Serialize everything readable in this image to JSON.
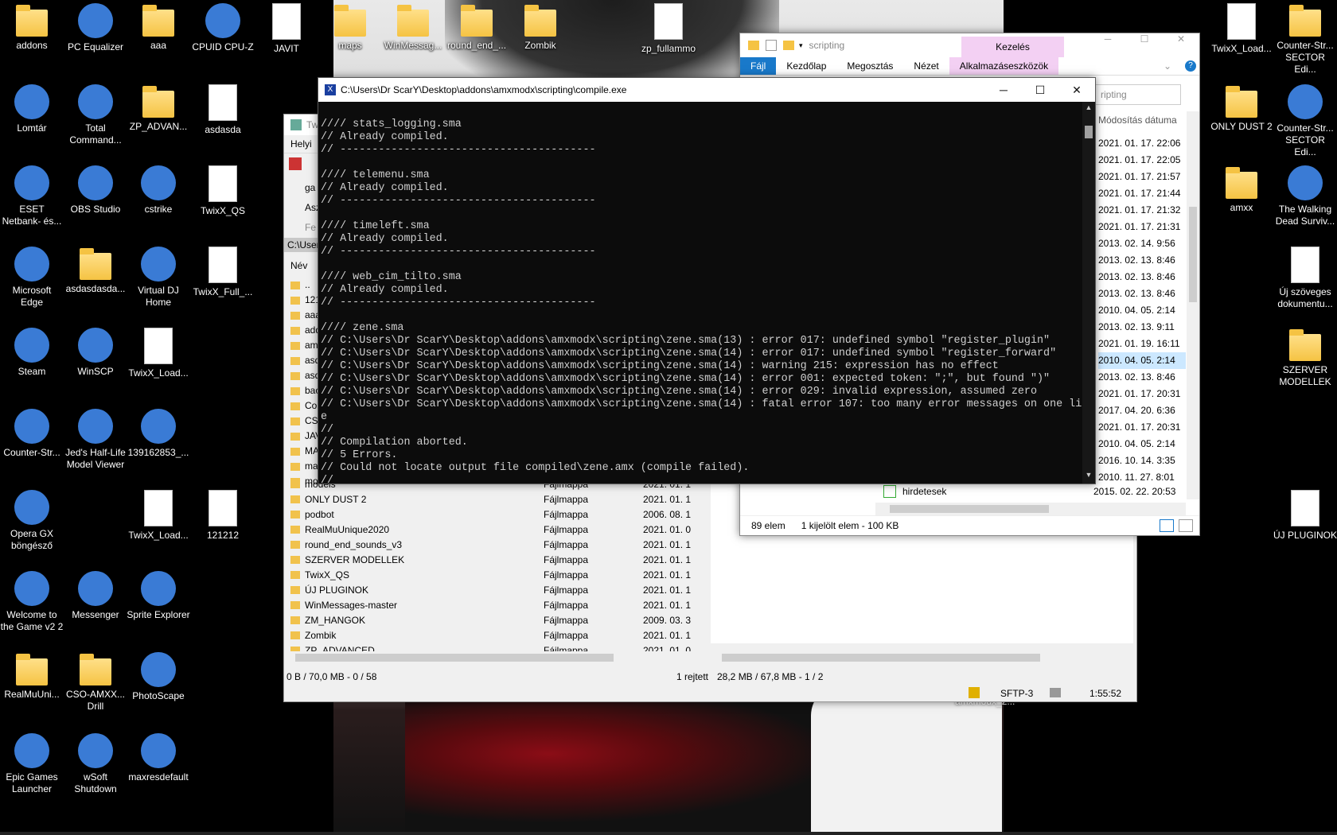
{
  "desktop": {
    "icons_left": [
      {
        "label": "addons",
        "icon": "folder-icon"
      },
      {
        "label": "PC Equalizer",
        "icon": "equalizer-icon"
      },
      {
        "label": "aaa",
        "icon": "folder-icon"
      },
      {
        "label": "CPUID CPU-Z",
        "icon": "cpu-icon"
      },
      {
        "label": "JAVIT",
        "icon": "text-file-icon"
      },
      {
        "label": "Lomtár",
        "icon": "recycle-bin-icon"
      },
      {
        "label": "Total Command...",
        "icon": "floppy-icon"
      },
      {
        "label": "ZP_ADVAN...",
        "icon": "folder-icon"
      },
      {
        "label": "asdasda",
        "icon": "text-file-icon"
      },
      {
        "label": "ESET Netbank- és...",
        "icon": "eset-icon"
      },
      {
        "label": "OBS Studio",
        "icon": "obs-icon"
      },
      {
        "label": "cstrike",
        "icon": "winrar-icon"
      },
      {
        "label": "TwixX_QS",
        "icon": "disc-file-icon"
      },
      {
        "label": "Microsoft Edge",
        "icon": "edge-icon"
      },
      {
        "label": "asdasdasda...",
        "icon": "folder-icon"
      },
      {
        "label": "Virtual DJ Home",
        "icon": "virtualdj-icon"
      },
      {
        "label": "TwixX_Full_...",
        "icon": "disc-file-icon"
      },
      {
        "label": "Steam",
        "icon": "steam-icon"
      },
      {
        "label": "WinSCP",
        "icon": "winscp-icon"
      },
      {
        "label": "TwixX_Load...",
        "icon": "disc-file-icon"
      },
      {
        "label": "Counter-Str...",
        "icon": "counter-strike-icon"
      },
      {
        "label": "Jed's Half-Life Model Viewer",
        "icon": "halflife-icon"
      },
      {
        "label": "139162853_...",
        "icon": "photo-icon"
      },
      {
        "label": "Opera GX böngésző",
        "icon": "opera-icon"
      },
      {
        "label": "TwixX_Load...",
        "icon": "disc-file-icon"
      },
      {
        "label": "121212",
        "icon": "text-file-icon"
      },
      {
        "label": "Welcome to the Game v2 2",
        "icon": "skull-icon"
      },
      {
        "label": "Messenger",
        "icon": "messenger-icon"
      },
      {
        "label": "Sprite Explorer",
        "icon": "sprite-explorer-icon"
      },
      {
        "label": "RealMuUni...",
        "icon": "folder-icon"
      },
      {
        "label": "CSO-AMXX... Drill",
        "icon": "folder-icon"
      },
      {
        "label": "PhotoScape",
        "icon": "photoscape-icon"
      },
      {
        "label": "Epic Games Launcher",
        "icon": "epic-games-icon"
      },
      {
        "label": "wSoft Shutdown",
        "icon": "shutdown-icon"
      },
      {
        "label": "maxresdefault",
        "icon": "photo-icon"
      }
    ],
    "icons_top": [
      {
        "label": "maps",
        "icon": "folder-icon"
      },
      {
        "label": "WinMessag...",
        "icon": "folder-icon"
      },
      {
        "label": "round_end_...",
        "icon": "folder-icon"
      },
      {
        "label": "Zombik",
        "icon": "folder-icon"
      },
      {
        "label": "zp_fullammo",
        "icon": "text-file-icon"
      }
    ],
    "icons_right": [
      {
        "label": "TwixX_Load...",
        "icon": "disc-file-icon"
      },
      {
        "label": "Counter-Str... SECTOR Edi...",
        "icon": "folder-icon"
      },
      {
        "label": "ONLY DUST 2",
        "icon": "folder-icon"
      },
      {
        "label": "Counter-Str... SECTOR Edi...",
        "icon": "counter-strike-icon"
      },
      {
        "label": "amxx",
        "icon": "folder-icon"
      },
      {
        "label": "The Walking Dead Surviv...",
        "icon": "walking-dead-icon"
      },
      {
        "label": "Új szöveges dokumentu...",
        "icon": "text-file-icon"
      },
      {
        "label": "SZERVER MODELLEK",
        "icon": "folder-icon"
      },
      {
        "label": "ÚJ PLUGINOK",
        "icon": "text-file-icon"
      }
    ],
    "partial_label": "amxmodx_2..."
  },
  "console": {
    "title": "C:\\Users\\Dr ScarY\\Desktop\\addons\\amxmodx\\scripting\\compile.exe",
    "lines": [
      "",
      "//// stats_logging.sma",
      "// Already compiled.",
      "// ----------------------------------------",
      "",
      "//// telemenu.sma",
      "// Already compiled.",
      "// ----------------------------------------",
      "",
      "//// timeleft.sma",
      "// Already compiled.",
      "// ----------------------------------------",
      "",
      "//// web_cim_tilto.sma",
      "// Already compiled.",
      "// ----------------------------------------",
      "",
      "//// zene.sma",
      "// C:\\Users\\Dr ScarY\\Desktop\\addons\\amxmodx\\scripting\\zene.sma(13) : error 017: undefined symbol \"register_plugin\"",
      "// C:\\Users\\Dr ScarY\\Desktop\\addons\\amxmodx\\scripting\\zene.sma(14) : error 017: undefined symbol \"register_forward\"",
      "// C:\\Users\\Dr ScarY\\Desktop\\addons\\amxmodx\\scripting\\zene.sma(14) : warning 215: expression has no effect",
      "// C:\\Users\\Dr ScarY\\Desktop\\addons\\amxmodx\\scripting\\zene.sma(14) : error 001: expected token: \";\", but found \")\"",
      "// C:\\Users\\Dr ScarY\\Desktop\\addons\\amxmodx\\scripting\\zene.sma(14) : error 029: invalid expression, assumed zero",
      "// C:\\Users\\Dr ScarY\\Desktop\\addons\\amxmodx\\scripting\\zene.sma(14) : fatal error 107: too many error messages on one lin",
      "e",
      "//",
      "// Compilation aborted.",
      "// 5 Errors.",
      "// Could not locate output file compiled\\zene.amx (compile failed).",
      "//"
    ]
  },
  "explorer": {
    "title": "scripting",
    "manage_tab": "Kezelés",
    "app_tools": "Alkalmazáseszközök",
    "tabs": [
      "Fájl",
      "Kezdőlap",
      "Megosztás",
      "Nézet"
    ],
    "search_placeholder": "ripting",
    "column_date": "Módosítás dátuma",
    "dates": [
      "2021. 01. 17. 22:06",
      "2021. 01. 17. 22:05",
      "2021. 01. 17. 21:57",
      "2021. 01. 17. 21:44",
      "2021. 01. 17. 21:32",
      "2021. 01. 17. 21:31",
      "2013. 02. 14. 9:56",
      "2013. 02. 13. 8:46",
      "2013. 02. 13. 8:46",
      "2013. 02. 13. 8:46",
      "2010. 04. 05. 2:14",
      "2013. 02. 13. 9:11",
      "2021. 01. 19. 16:11",
      "2010. 04. 05. 2:14",
      "2013. 02. 13. 8:46",
      "2021. 01. 17. 20:31",
      "2017. 04. 20. 6:36",
      "2021. 01. 17. 20:31",
      "2010. 04. 05. 2:14",
      "2016. 10. 14. 3:35",
      "2010. 11. 27. 8:01"
    ],
    "last_file": {
      "name": "hirdetesek",
      "date": "2015. 02. 22. 20:53"
    },
    "status_count": "89 elem",
    "status_selected": "1 kijelölt elem - 100 KB"
  },
  "totalcmd": {
    "title_partial": "Tw",
    "menu_partial": "Helyi",
    "path_partial": "C:\\Users",
    "col_name": "Név",
    "drive_items": [
      "ga",
      "Asz",
      "Fe"
    ],
    "partial_rows": [
      "..",
      "1212",
      "aaa",
      "add",
      "amx",
      "asda",
      "asda",
      "back",
      "Cou",
      "CSO",
      "JAVI",
      "MAL",
      "map",
      "mod"
    ],
    "rows": [
      {
        "name": "models",
        "type": "Fájlmappa",
        "date": "2021. 01. 1"
      },
      {
        "name": "ONLY DUST 2",
        "type": "Fájlmappa",
        "date": "2021. 01. 1"
      },
      {
        "name": "podbot",
        "type": "Fájlmappa",
        "date": "2006. 08. 1"
      },
      {
        "name": "RealMuUnique2020",
        "type": "Fájlmappa",
        "date": "2021. 01. 0"
      },
      {
        "name": "round_end_sounds_v3",
        "type": "Fájlmappa",
        "date": "2021. 01. 1"
      },
      {
        "name": "SZERVER MODELLEK",
        "type": "Fájlmappa",
        "date": "2021. 01. 1"
      },
      {
        "name": "TwixX_QS",
        "type": "Fájlmappa",
        "date": "2021. 01. 1"
      },
      {
        "name": "ÚJ PLUGINOK",
        "type": "Fájlmappa",
        "date": "2021. 01. 1"
      },
      {
        "name": "WinMessages-master",
        "type": "Fájlmappa",
        "date": "2021. 01. 1"
      },
      {
        "name": "ZM_HANGOK",
        "type": "Fájlmappa",
        "date": "2009. 03. 3"
      },
      {
        "name": "Zombik",
        "type": "Fájlmappa",
        "date": "2021. 01. 1"
      },
      {
        "name": "ZP_ADVANCED",
        "type": "Fájlmappa",
        "date": "2021. 01. 0"
      }
    ],
    "status_left": "0 B / 70,0 MB - 0 / 58",
    "status_hidden": "1 rejtett",
    "status_right": "28,2 MB / 67,8 MB - 1 / 2",
    "sftp": "SFTP-3",
    "timer": "1:55:52"
  }
}
